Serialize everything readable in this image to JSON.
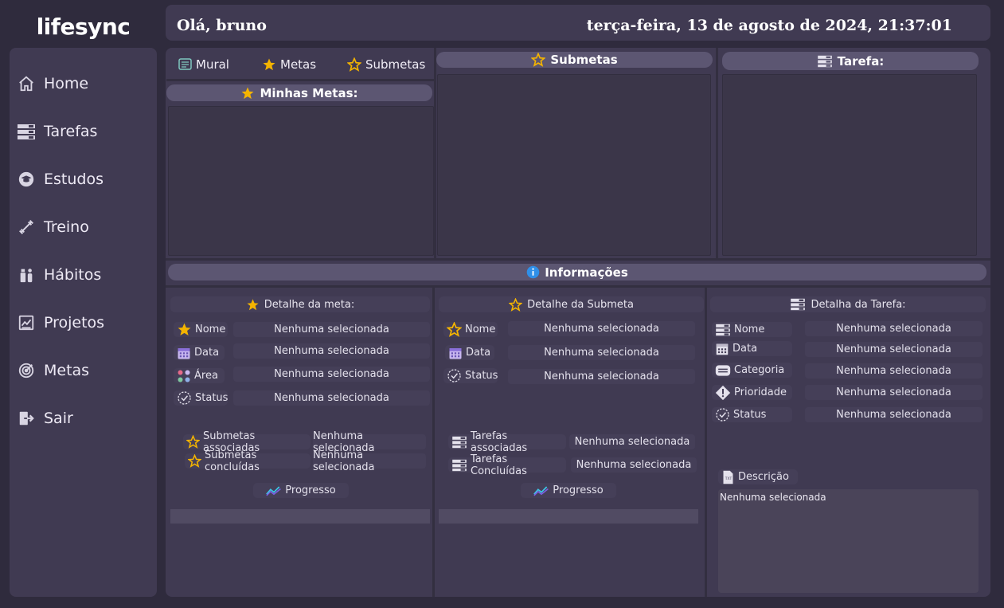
{
  "app": {
    "logo": "lifesync"
  },
  "header": {
    "greeting": "Olá, bruno",
    "datetime": "terça-feira, 13 de agosto de 2024, 21:37:01"
  },
  "sidebar": {
    "items": [
      {
        "label": "Home",
        "icon": "home-icon"
      },
      {
        "label": "Tarefas",
        "icon": "tasks-icon"
      },
      {
        "label": "Estudos",
        "icon": "graduation-icon"
      },
      {
        "label": "Treino",
        "icon": "dumbbell-icon"
      },
      {
        "label": "Hábitos",
        "icon": "habits-icon"
      },
      {
        "label": "Projetos",
        "icon": "chart-icon"
      },
      {
        "label": "Metas",
        "icon": "target-icon"
      },
      {
        "label": "Sair",
        "icon": "logout-icon"
      }
    ]
  },
  "tabs": {
    "mural": "Mural",
    "metas": "Metas",
    "submetas": "Submetas"
  },
  "panels": {
    "minhas_metas": "Minhas Metas:",
    "submetas": "Submetas",
    "tarefa": "Tarefa:",
    "informacoes": "Informações"
  },
  "meta_detail": {
    "title": "Detalhe da meta:",
    "fields": [
      {
        "label": "Nome",
        "value": "Nenhuma selecionada"
      },
      {
        "label": "Data",
        "value": "Nenhuma selecionada"
      },
      {
        "label": "Área",
        "value": "Nenhuma selecionada"
      },
      {
        "label": "Status",
        "value": "Nenhuma selecionada"
      }
    ],
    "submetas_associadas": "Submetas associadas",
    "submetas_associadas_value": "Nenhuma selecionada",
    "submetas_concluidas": "Submetas concluídas",
    "submetas_concluidas_value": "Nenhuma selecionada",
    "progresso": "Progresso"
  },
  "submeta_detail": {
    "title": "Detalhe da Submeta",
    "fields": [
      {
        "label": "Nome",
        "value": "Nenhuma selecionada"
      },
      {
        "label": "Data",
        "value": "Nenhuma selecionada"
      },
      {
        "label": "Status",
        "value": "Nenhuma selecionada"
      }
    ],
    "tarefas_associadas": "Tarefas associadas",
    "tarefas_associadas_value": "Nenhuma selecionada",
    "tarefas_concluidas": "Tarefas Concluídas",
    "tarefas_concluidas_value": "Nenhuma selecionada",
    "progresso": "Progresso"
  },
  "tarefa_detail": {
    "title": "Detalha da Tarefa:",
    "fields": [
      {
        "label": "Nome",
        "value": "Nenhuma selecionada"
      },
      {
        "label": "Data",
        "value": "Nenhuma selecionada"
      },
      {
        "label": "Categoria",
        "value": "Nenhuma selecionada"
      },
      {
        "label": "Prioridade",
        "value": "Nenhuma selecionada"
      },
      {
        "label": "Status",
        "value": "Nenhuma selecionada"
      }
    ],
    "descricao_label": "Descrição",
    "descricao_value": "Nenhuma selecionada"
  },
  "colors": {
    "background": "#2f2b3d",
    "card": "#403a52",
    "pill": "#5c5672",
    "star": "#f4b400",
    "info": "#2f8fe8"
  }
}
